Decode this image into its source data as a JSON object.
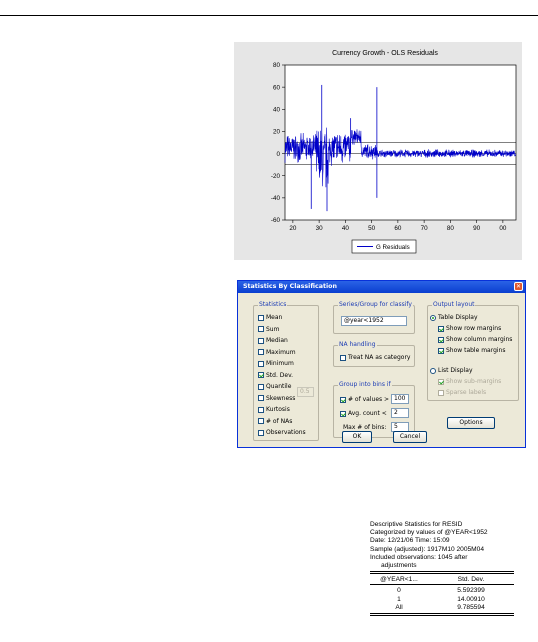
{
  "chart_data": {
    "type": "line",
    "title": "Currency Growth - OLS Residuals",
    "xlabel": "",
    "ylabel": "",
    "xlim": [
      1917,
      2005
    ],
    "ylim": [
      -60,
      80
    ],
    "x_tick_labels": [
      "20",
      "30",
      "40",
      "50",
      "60",
      "70",
      "80",
      "90",
      "00"
    ],
    "y_tick_labels": [
      "80",
      "60",
      "40",
      "20",
      "0",
      "-20",
      "-40",
      "-60"
    ],
    "y_ticks": [
      80,
      60,
      40,
      20,
      0,
      -20,
      -40,
      -60
    ],
    "reference_lines": [
      0,
      10,
      -10
    ],
    "legend": "bottom-center",
    "series": [
      {
        "name": "G Residuals",
        "color": "#0000c8",
        "approx_segments": [
          {
            "x_from": 1917,
            "x_to": 1929,
            "mean": 5,
            "amplitude": 14
          },
          {
            "x_from": 1929,
            "x_to": 1934,
            "mean": -5,
            "amplitude": 35
          },
          {
            "x_from": 1934,
            "x_to": 1942,
            "mean": 5,
            "amplitude": 18
          },
          {
            "x_from": 1942,
            "x_to": 1946,
            "mean": 15,
            "amplitude": 8
          },
          {
            "x_from": 1946,
            "x_to": 1952,
            "mean": 2,
            "amplitude": 8
          },
          {
            "x_from": 1952,
            "x_to": 2005,
            "mean": 0,
            "amplitude": 4
          }
        ],
        "spikes": [
          [
            1931,
            62
          ],
          [
            1933,
            -52
          ],
          [
            1942,
            32
          ],
          [
            1952,
            60
          ],
          [
            1952,
            -40
          ],
          [
            1927,
            -50
          ]
        ]
      }
    ]
  },
  "dialog": {
    "title": "Statistics By Classification",
    "statistics_group": {
      "label": "Statistics",
      "items": [
        {
          "label": "Mean",
          "checked": false
        },
        {
          "label": "Sum",
          "checked": false
        },
        {
          "label": "Median",
          "checked": false
        },
        {
          "label": "Maximum",
          "checked": false
        },
        {
          "label": "Minimum",
          "checked": false
        },
        {
          "label": "Std. Dev.",
          "checked": true
        },
        {
          "label": "Quantile",
          "checked": false
        },
        {
          "label": "Skewness",
          "checked": false
        },
        {
          "label": "Kurtosis",
          "checked": false
        },
        {
          "label": "# of NAs",
          "checked": false
        },
        {
          "label": "Observations",
          "checked": false
        }
      ],
      "quantile_value": "0.5"
    },
    "series_group": {
      "label": "Series/Group for classify",
      "value": "@year<1952"
    },
    "na_group": {
      "label": "NA handling",
      "treat_na_label": "Treat NA as category",
      "treat_na_checked": false
    },
    "bins_group": {
      "label": "Group into bins if",
      "values_label": "# of values >",
      "values_checked": true,
      "values_value": "100",
      "avg_label": "Avg. count <",
      "avg_checked": true,
      "avg_value": "2",
      "max_label": "Max # of bins:",
      "max_value": "5"
    },
    "output_group": {
      "label": "Output layout",
      "table_display": "Table Display",
      "table_display_selected": true,
      "row_margins": "Show row margins",
      "column_margins": "Show column margins",
      "table_margins": "Show table margins",
      "list_display": "List Display",
      "list_display_selected": false,
      "sub_margins": "Show sub-margins",
      "sparse_labels": "Sparse labels"
    },
    "options_button": "Options",
    "ok_button": "OK",
    "cancel_button": "Cancel"
  },
  "output": {
    "lines": [
      "Descriptive Statistics for RESID",
      "Categorized by values of @YEAR<1952",
      "Date: 12/21/06   Time: 15:09",
      "Sample (adjusted): 1917M10 2005M04",
      "Included observations: 1045 after"
    ],
    "indent_line": "adjustments",
    "columns": [
      "@YEAR<1...",
      "Std. Dev."
    ],
    "rows": [
      [
        "0",
        "5.592399"
      ],
      [
        "1",
        "14.00910"
      ],
      [
        "All",
        "9.785594"
      ]
    ]
  }
}
